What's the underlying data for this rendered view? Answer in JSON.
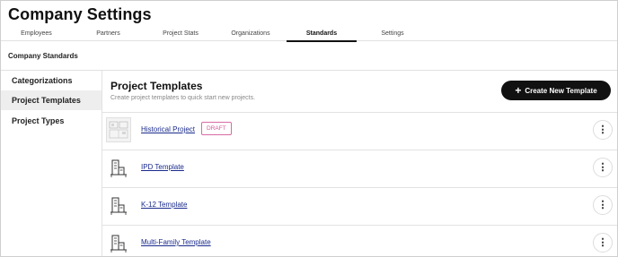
{
  "app": {
    "title": "Company Settings"
  },
  "tabs": [
    {
      "label": "Employees"
    },
    {
      "label": "Partners"
    },
    {
      "label": "Project Stats"
    },
    {
      "label": "Organizations"
    },
    {
      "label": "Standards",
      "active": true
    },
    {
      "label": "Settings"
    }
  ],
  "section": {
    "title": "Company Standards"
  },
  "sidebar": {
    "items": [
      {
        "label": "Categorizations"
      },
      {
        "label": "Project Templates",
        "active": true
      },
      {
        "label": "Project Types"
      }
    ]
  },
  "main": {
    "title": "Project Templates",
    "subtitle": "Create project templates to quick start new projects.",
    "create_button": {
      "icon": "plus-icon",
      "label": "Create New Template"
    },
    "templates": [
      {
        "name": "Historical Project",
        "badge": "DRAFT",
        "thumbnail": "floorplan-thumbnail",
        "menu_icon": "more-vertical-icon"
      },
      {
        "name": "IPD Template",
        "thumbnail": "building-icon",
        "menu_icon": "more-vertical-icon"
      },
      {
        "name": "K-12 Template",
        "thumbnail": "building-icon",
        "menu_icon": "more-vertical-icon"
      },
      {
        "name": "Multi-Family Template",
        "thumbnail": "building-icon",
        "menu_icon": "more-vertical-icon"
      }
    ]
  },
  "colors": {
    "accent": "#111111",
    "badge": "#d25a9a",
    "link": "#1a2b8c"
  }
}
